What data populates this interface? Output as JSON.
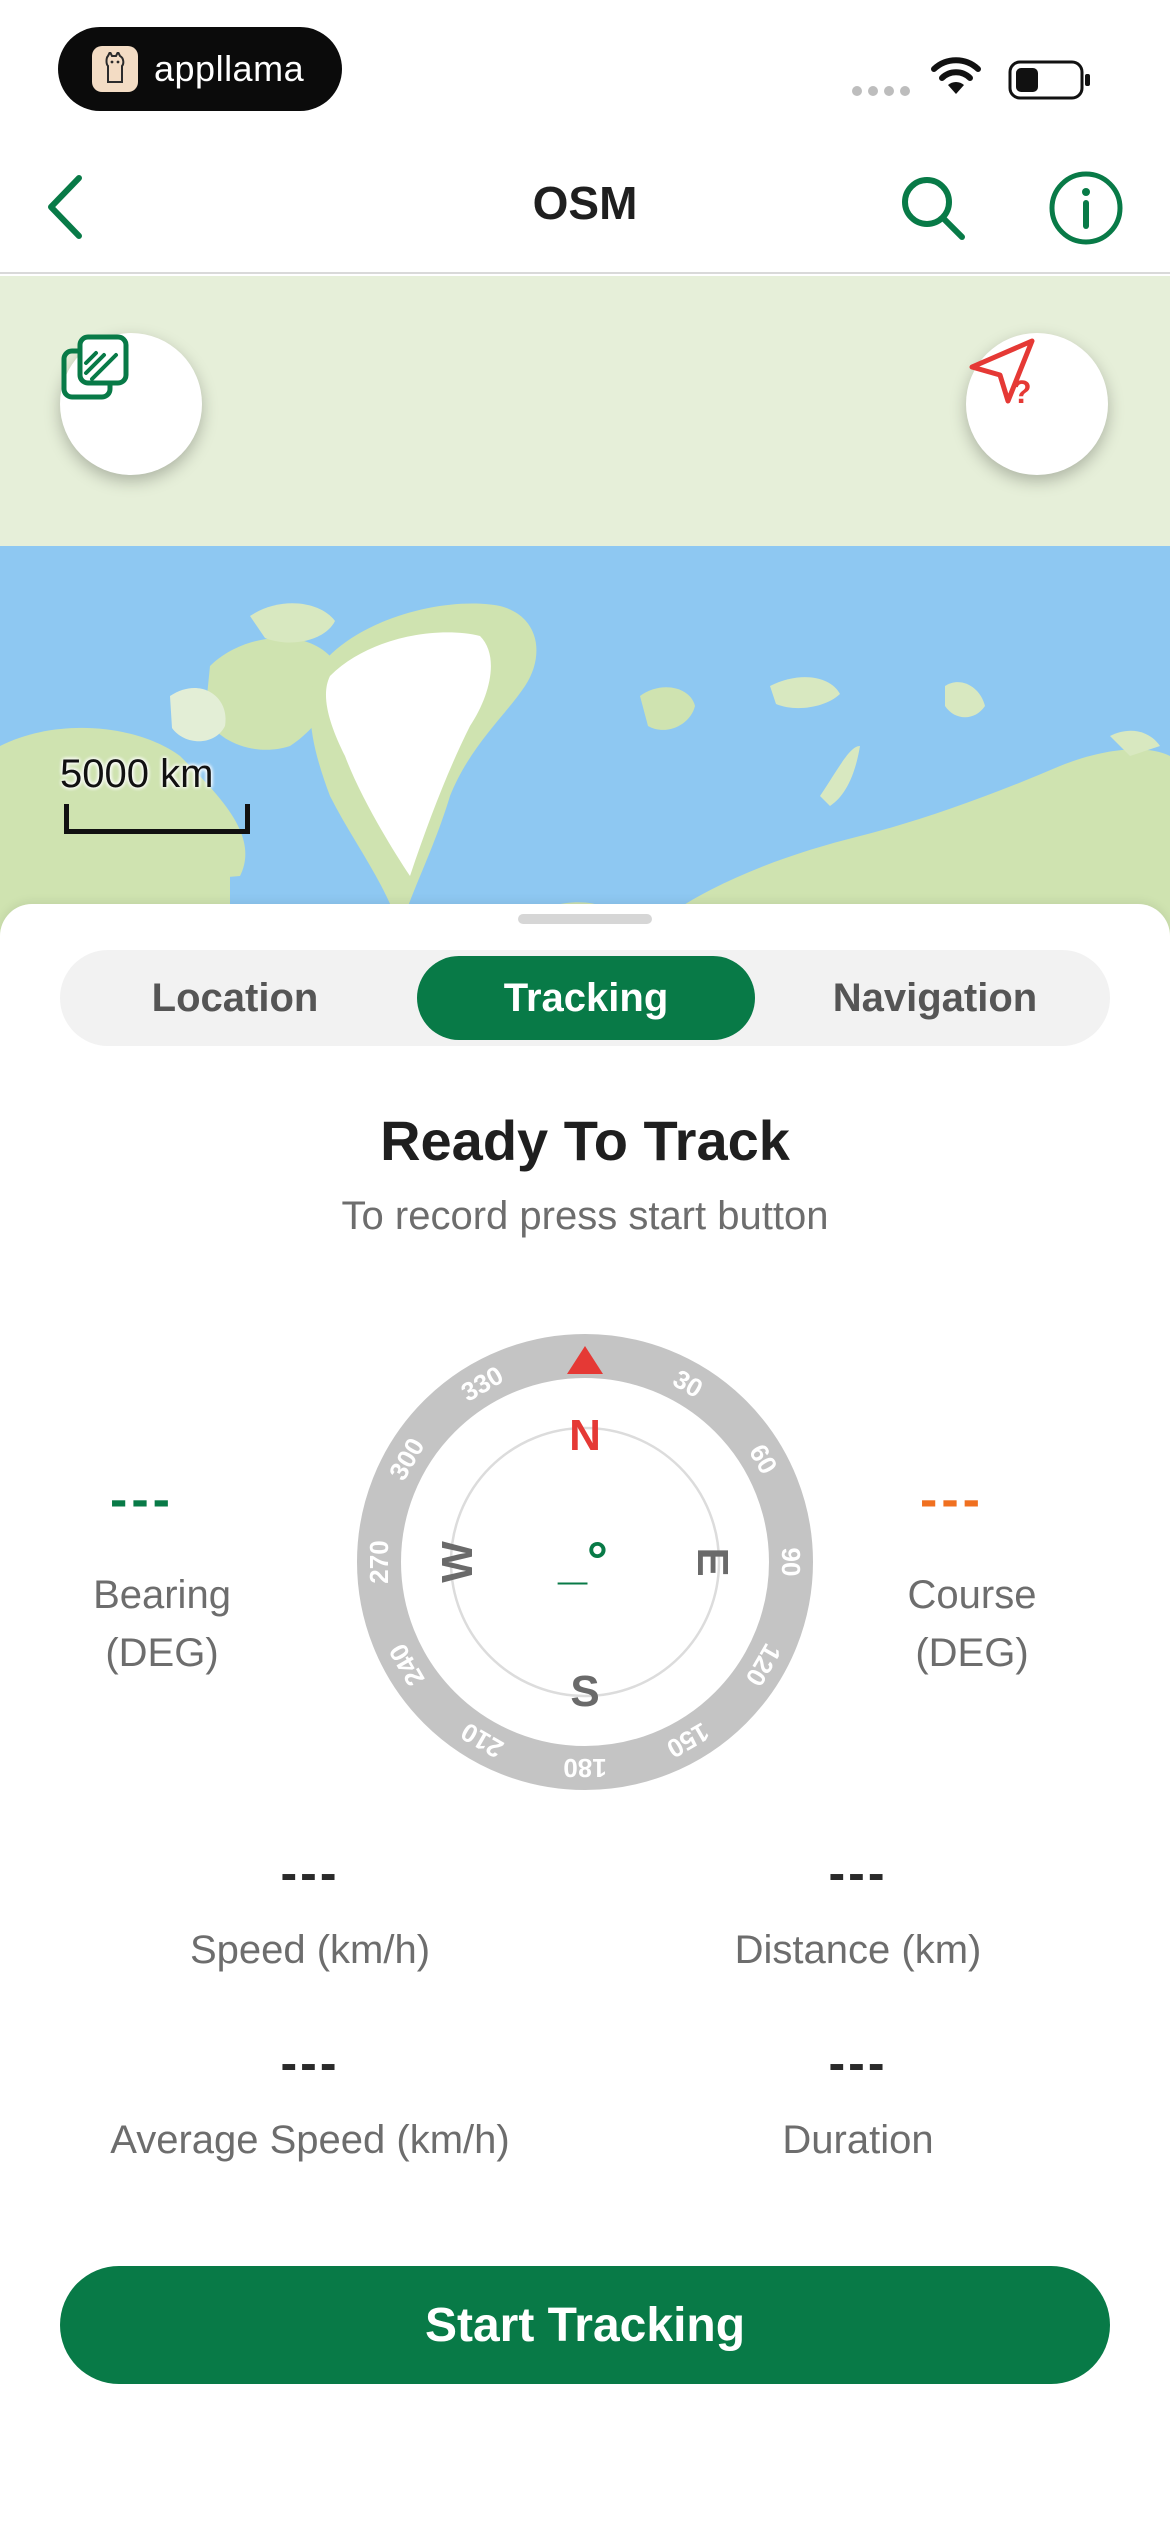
{
  "status_bar": {
    "brand_name": "appllama"
  },
  "nav": {
    "title": "OSM",
    "icons": [
      "chevron-left-icon",
      "search-icon",
      "info-icon"
    ]
  },
  "map": {
    "scale_label": "5000 km",
    "fab_icons": [
      "layers-icon",
      "location-unknown-icon"
    ]
  },
  "tabs": [
    {
      "label": "Location",
      "selected": false
    },
    {
      "label": "Tracking",
      "selected": true
    },
    {
      "label": "Navigation",
      "selected": false
    }
  ],
  "tracking": {
    "title": "Ready To Track",
    "subtitle": "To record press start button"
  },
  "compass": {
    "north": "N",
    "east": "E",
    "south": "S",
    "west": "W",
    "heading_readout": "_°",
    "ticks": [
      "30",
      "60",
      "90",
      "120",
      "150",
      "180",
      "210",
      "240",
      "270",
      "300",
      "330"
    ]
  },
  "bearing": {
    "value": "---",
    "label_line1": "Bearing",
    "label_line2": "(DEG)"
  },
  "course": {
    "value": "---",
    "label_line1": "Course",
    "label_line2": "(DEG)"
  },
  "stats": {
    "speed": {
      "value": "---",
      "label": "Speed (km/h)"
    },
    "distance": {
      "value": "---",
      "label": "Distance (km)"
    },
    "average_speed": {
      "value": "---",
      "label": "Average Speed (km/h)"
    },
    "duration": {
      "value": "---",
      "label": "Duration"
    }
  },
  "start_button": {
    "label": "Start Tracking"
  },
  "colors": {
    "accent_green": "#087a47",
    "north_red": "#e53935",
    "course_orange": "#f07020",
    "ocean": "#8ec8f2",
    "land": "#cfe3b0"
  }
}
